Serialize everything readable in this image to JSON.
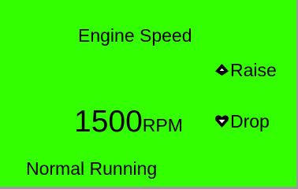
{
  "screen": {
    "title": "Engine Speed",
    "speed_value": "1500",
    "speed_unit": "RPM",
    "raise_label": "Raise",
    "drop_label": "Drop",
    "status": "Normal Running",
    "raise_icon": "triangle-up-icon",
    "drop_icon": "heart-down-icon"
  },
  "colors": {
    "background": "#33ff00",
    "text": "#000000",
    "border": "#9a9a9a"
  }
}
